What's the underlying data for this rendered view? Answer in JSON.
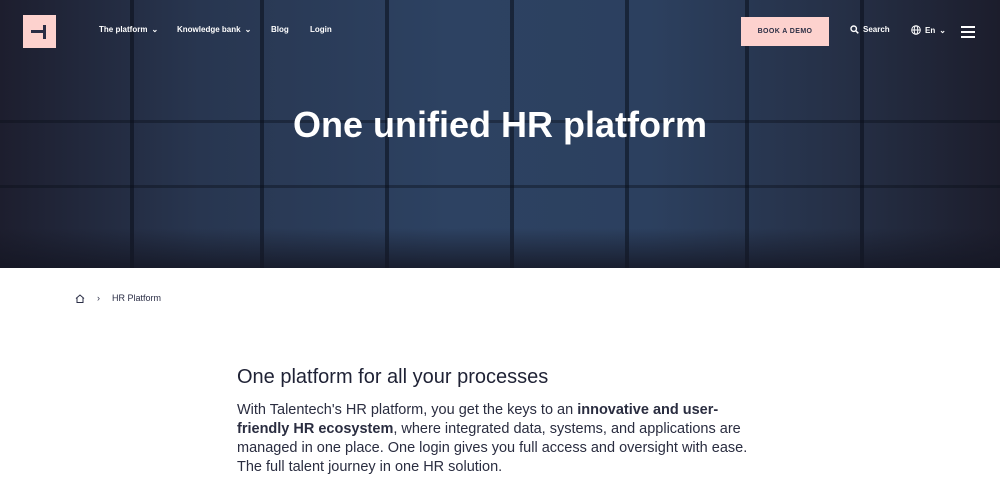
{
  "header": {
    "nav": [
      "The platform",
      "Knowledge bank",
      "Blog",
      "Login"
    ],
    "book_demo": "BOOK A DEMO",
    "search": "Search",
    "language": "En"
  },
  "hero": {
    "title": "One unified HR platform"
  },
  "breadcrumb": {
    "current": "HR Platform"
  },
  "intro": {
    "heading": "One platform for all your processes",
    "p1": "With Talentech's HR platform, you get the keys to an ",
    "b1": "innovative and user-friendly HR ecosystem",
    "p2": ", where integrated data, systems, and applications are managed in one place. One login gives you full access and oversight with ease. The full talent journey in one HR solution."
  },
  "colors": {
    "accent": "#fdd2ce",
    "text": "#1f2235"
  }
}
